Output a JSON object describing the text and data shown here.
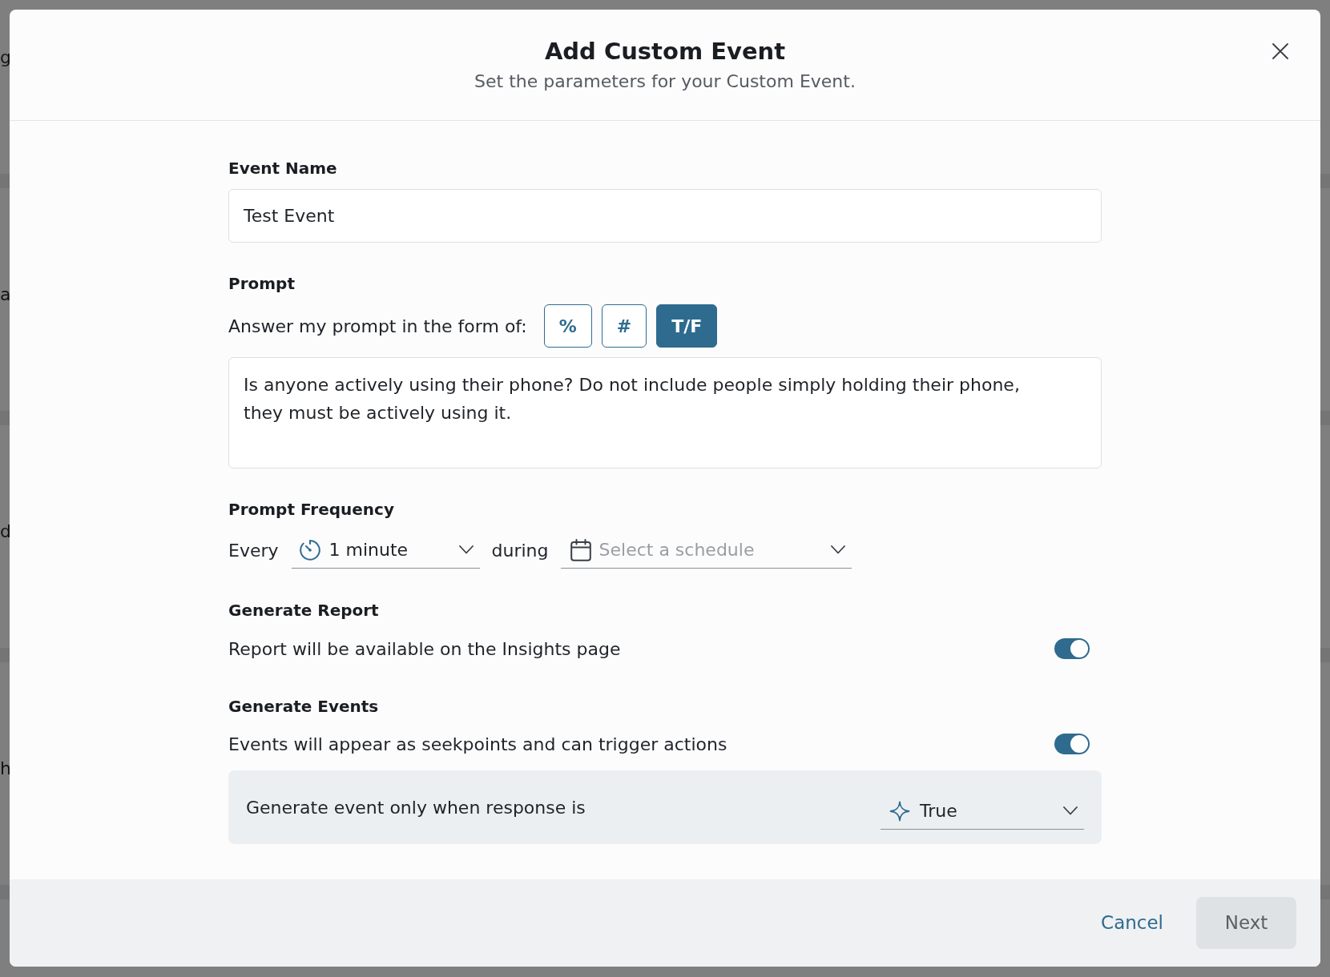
{
  "background": {
    "fragments": [
      "g",
      "a",
      "d",
      "h"
    ]
  },
  "dialog": {
    "title": "Add Custom Event",
    "subtitle": "Set the parameters for your Custom Event."
  },
  "event_name": {
    "label": "Event Name",
    "value": "Test Event"
  },
  "prompt": {
    "label": "Prompt",
    "format_label": "Answer my prompt in the form of:",
    "formats": [
      {
        "label": "%",
        "selected": false
      },
      {
        "label": "#",
        "selected": false
      },
      {
        "label": "T/F",
        "selected": true
      }
    ],
    "value": "Is anyone actively using their phone? Do not include people simply holding their phone, they must be actively using it."
  },
  "frequency": {
    "label": "Prompt Frequency",
    "every_label": "Every",
    "interval": "1 minute",
    "during_label": "during",
    "schedule": {
      "placeholder": "Select a schedule"
    }
  },
  "settings": [
    {
      "label": "Generate Report",
      "description": "Report will be available on the Insights page",
      "on": true
    },
    {
      "label": "Generate Events",
      "description": "Events will appear as seekpoints and can trigger actions",
      "on": true
    }
  ],
  "condition": {
    "label": "Generate event only when response is",
    "value": "True"
  },
  "footer": {
    "buttons": [
      {
        "label": "Cancel",
        "kind": "link",
        "disabled": false
      },
      {
        "label": "Next",
        "kind": "solid",
        "disabled": true
      }
    ]
  }
}
